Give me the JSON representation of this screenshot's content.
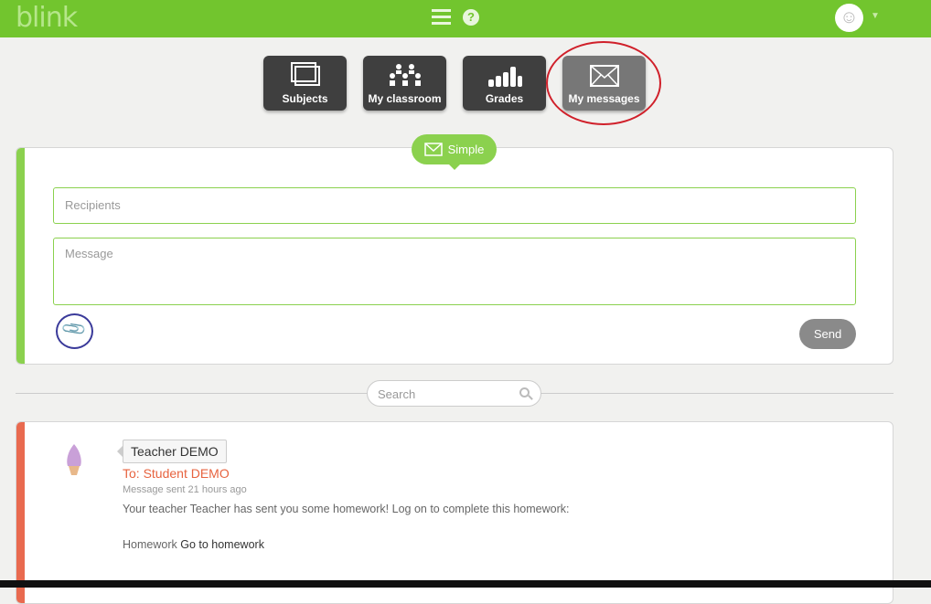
{
  "header": {
    "logo": "blink",
    "menu_icon": "hamburger-icon",
    "help_icon": "question-icon",
    "avatar_icon": "smiley-icon",
    "brand_color": "#72c52e"
  },
  "tabs": [
    {
      "label": "Subjects",
      "icon": "subjects-icon"
    },
    {
      "label": "My classroom",
      "icon": "classroom-icon"
    },
    {
      "label": "Grades",
      "icon": "grades-icon"
    },
    {
      "label": "My messages",
      "icon": "envelope-icon",
      "active": true
    }
  ],
  "compose": {
    "mode": "Simple",
    "recipients_placeholder": "Recipients",
    "message_placeholder": "Message",
    "send_label": "Send",
    "attach_icon": "paperclip-icon"
  },
  "search": {
    "placeholder": "Search"
  },
  "messages": [
    {
      "sender": "Teacher DEMO",
      "to": "To: Student DEMO",
      "sent": "Message sent 21 hours ago",
      "body": "Your teacher Teacher has sent you some homework! Log on to complete this homework:",
      "link_prefix": "Homework",
      "link_label": "Go to homework",
      "accent": "#e96a4f"
    }
  ]
}
